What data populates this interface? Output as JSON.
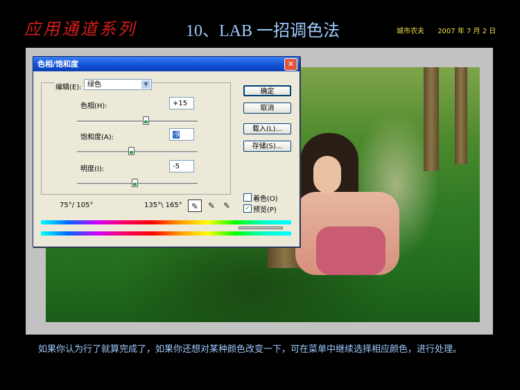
{
  "header": {
    "series": "应用通道系列",
    "title": "10、LAB 一招调色法",
    "author": "城市农夫",
    "date": "2007 年 7 月 2 日"
  },
  "dialog": {
    "title": "色相/饱和度",
    "close_label": "✕",
    "edit_label": "编辑(E):",
    "edit_value": "绿色",
    "hue_label": "色相(H):",
    "hue_value": "+15",
    "sat_label": "饱和度(A):",
    "sat_value": "-9",
    "light_label": "明度(I):",
    "light_value": "-5",
    "sliders": {
      "hue": 0.57,
      "saturation": 0.45,
      "lightness": 0.475
    },
    "range_left": "75°/ 105°",
    "range_right": "135°\\ 165°",
    "buttons": {
      "ok": "确定",
      "cancel": "取消",
      "load": "载入(L)...",
      "save": "存储(S)..."
    },
    "colorize_label": "着色(O)",
    "colorize_checked": false,
    "preview_label": "预览(P)",
    "preview_checked": true,
    "preview_check_glyph": "✓",
    "eyedroppers": [
      "eyedropper-icon",
      "eyedropper-plus-icon",
      "eyedropper-minus-icon"
    ]
  },
  "caption": "如果你认为行了就算完成了，如果你还想对某种颜色改变一下，可在菜单中继续选择相应颜色，进行处理。"
}
